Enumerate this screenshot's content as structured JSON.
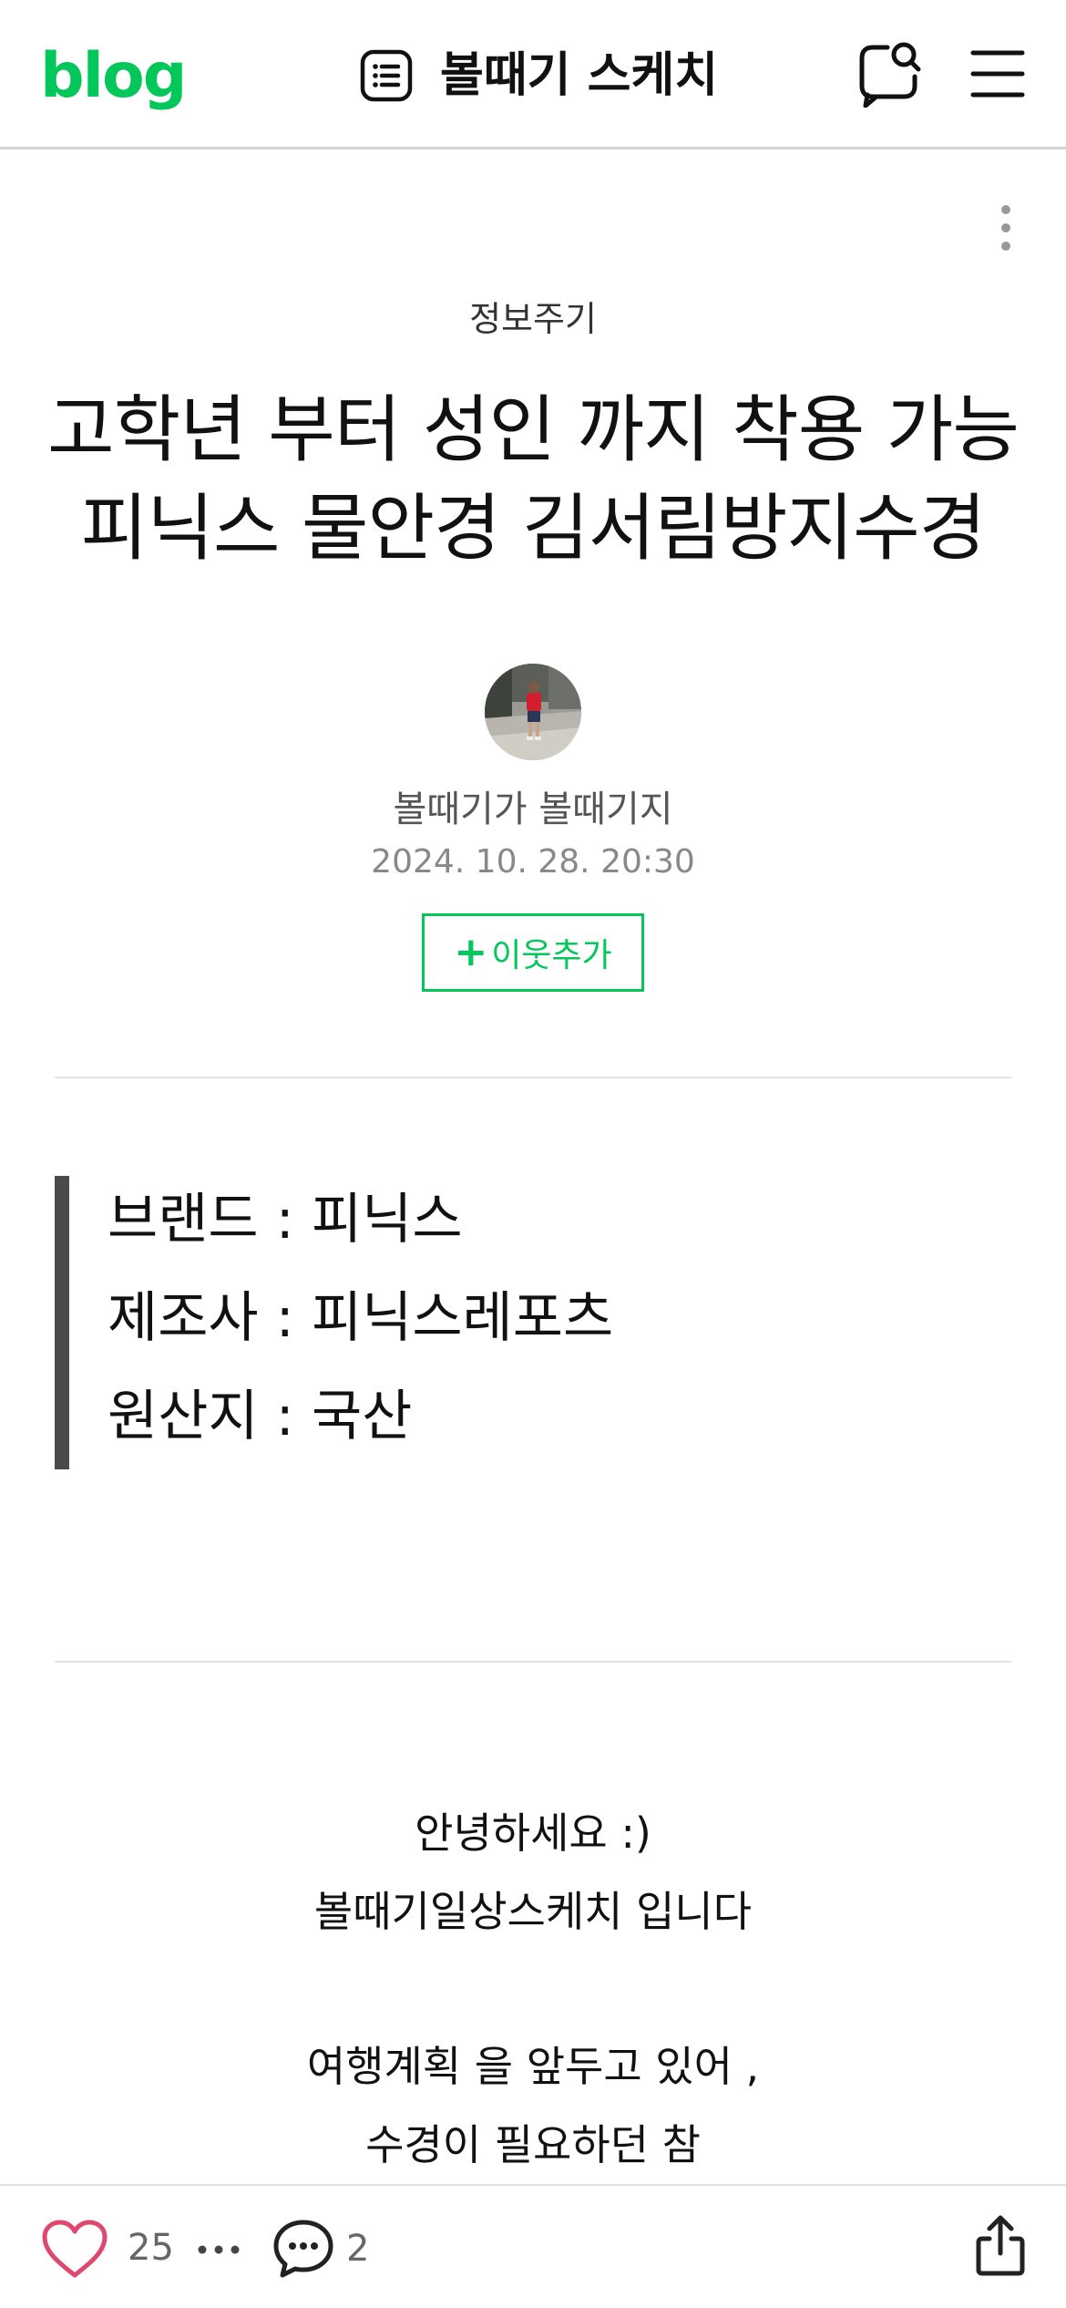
{
  "header": {
    "logo": "blog",
    "blog_title": "볼때기 스케치",
    "icons": {
      "list": "list-icon",
      "search": "search-icon",
      "menu": "hamburger-menu-icon"
    },
    "accent_color": "#03c75a"
  },
  "post": {
    "category": "정보주기",
    "title_lines": [
      "고학년 부터 성인 까지 착용 가능",
      "피닉스 물안경 김서림방지수경"
    ],
    "author": "볼때기가 볼때기지",
    "date": "2024. 10. 28. 20:30",
    "follow_label": "이웃추가",
    "follow_icon": "plus-icon",
    "more_icon": "vertical-dots-icon"
  },
  "quote": {
    "lines": [
      "브랜드 : 피닉스",
      "제조사 : 피닉스레포츠",
      "원산지 : 국산"
    ]
  },
  "body": {
    "lines": [
      "안녕하세요 :)",
      "볼때기일상스케치 입니다",
      "여행계획 을 앞두고 있어 ,",
      "수경이 필요하던 참"
    ]
  },
  "bottom_bar": {
    "like_count": "25",
    "comment_count": "2",
    "icons": {
      "like": "heart-icon",
      "more": "horizontal-dots-icon",
      "comment": "comment-bubble-icon",
      "share": "share-icon"
    },
    "like_color": "#e0476f"
  }
}
